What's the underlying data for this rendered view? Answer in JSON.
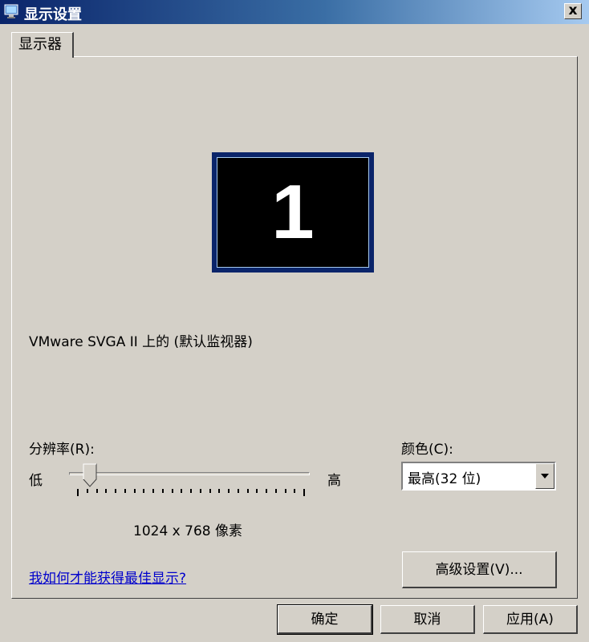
{
  "window": {
    "title": "显示设置",
    "close_label": "x"
  },
  "tabs": [
    {
      "label": "显示器"
    }
  ],
  "monitor": {
    "number": "1",
    "description": "VMware SVGA II 上的 (默认监视器)"
  },
  "resolution": {
    "label": "分辨率(R):",
    "low_label": "低",
    "high_label": "高",
    "value_text": "1024 x 768 像素",
    "level": 0.08
  },
  "color": {
    "label": "颜色(C):",
    "selected": "最高(32 位)"
  },
  "help_link": "我如何才能获得最佳显示?",
  "advanced_button": "高级设置(V)...",
  "footer": {
    "ok": "确定",
    "cancel": "取消",
    "apply": "应用(A)"
  }
}
